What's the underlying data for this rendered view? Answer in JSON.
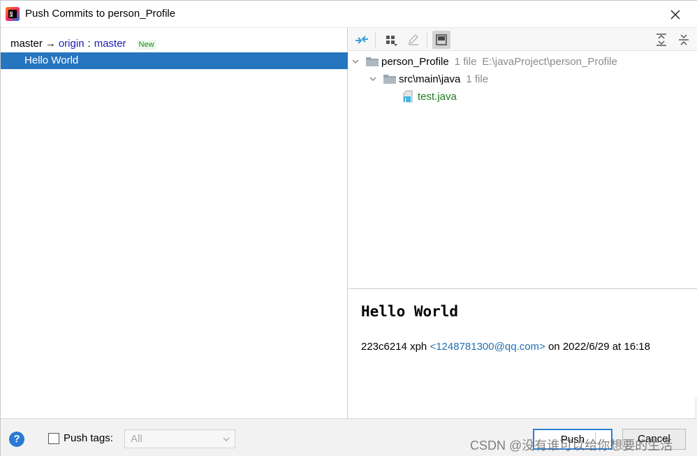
{
  "window": {
    "title": "Push Commits to person_Profile"
  },
  "branch": {
    "local": "master",
    "arrow": "→",
    "remote": "origin",
    "separator": ":",
    "remote_branch": "master",
    "badge": "New"
  },
  "commits": [
    {
      "message": "Hello World"
    }
  ],
  "tree": {
    "root": {
      "name": "person_Profile",
      "count": "1 file",
      "path": "E:\\javaProject\\person_Profile"
    },
    "folder": {
      "name": "src\\main\\java",
      "count": "1 file"
    },
    "file": {
      "name": "test.java"
    }
  },
  "details": {
    "message": "Hello World",
    "hash": "223c6214",
    "author": "xph",
    "email": "<1248781300@qq.com>",
    "date": "on 2022/6/29 at 16:18"
  },
  "footer": {
    "help": "?",
    "push_tags_label": "Push tags:",
    "tags_select_value": "All",
    "push_label": "Push",
    "cancel_label": "Cancel"
  },
  "watermark": "CSDN @没有谁可以给你想要的生活",
  "colors": {
    "selection": "#2675bf",
    "link": "#2470b3",
    "remote_branch": "#1a1ab5",
    "new_badge": "#1a8a1a",
    "file_added": "#1a7a1a",
    "primary_border": "#2f7fd1"
  },
  "icons": {
    "app": "intellij-icon",
    "close": "close-icon",
    "toolbar": [
      "merge-arrows-icon",
      "group-by-icon",
      "edit-icon",
      "preview-icon",
      "expand-all-icon",
      "collapse-all-icon"
    ],
    "tree": [
      "chevron-down-icon",
      "folder-icon",
      "java-file-icon"
    ]
  }
}
